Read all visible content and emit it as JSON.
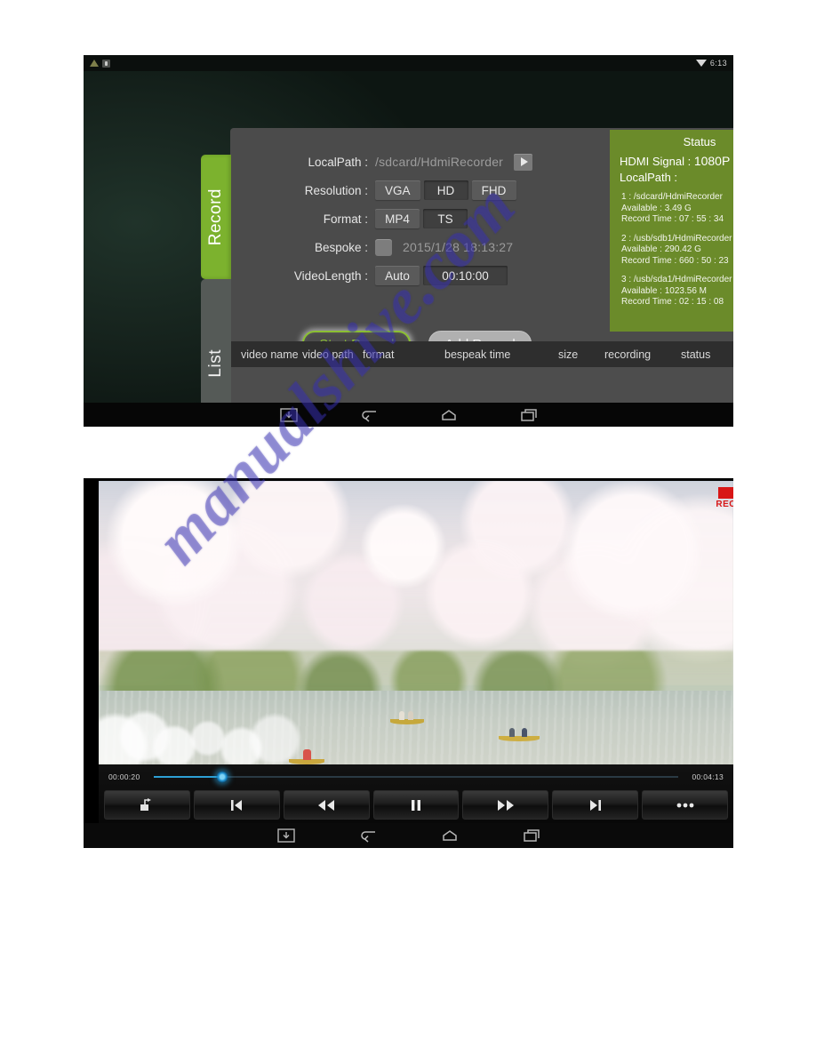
{
  "watermark": {
    "text": "manualshive.com"
  },
  "shot1": {
    "statusbar": {
      "time": "6:13",
      "wifi_icon": "wifi-icon",
      "notif_icons": [
        "triangle-icon",
        "sd-card-icon"
      ]
    },
    "tabs": [
      {
        "label": "Record",
        "active": true,
        "color": "#7cb22e"
      },
      {
        "label": "List",
        "active": false,
        "color": "#555a57"
      }
    ],
    "form": {
      "localpath": {
        "label": "LocalPath :",
        "value": "/sdcard/HdmiRecorder",
        "play_icon": "play-icon"
      },
      "resolution": {
        "label": "Resolution :",
        "options": [
          "VGA",
          "HD",
          "FHD"
        ],
        "selected": "HD"
      },
      "format": {
        "label": "Format :",
        "options": [
          "MP4",
          "TS"
        ],
        "selected": "TS"
      },
      "bespoke": {
        "label": "Bespoke :",
        "checked": false,
        "datetime": "2015/1/28 18:13:27"
      },
      "videolength": {
        "label": "VideoLength :",
        "options": [
          "Auto",
          "00:10:00"
        ],
        "selected": "00:10:00"
      }
    },
    "actions": {
      "start": "Start Record",
      "add": "Add Record"
    },
    "status": {
      "title": "Status",
      "hdmi_label": "HDMI Signal :",
      "hdmi_value": "1080P",
      "localpath_label": "LocalPath :",
      "entries": [
        {
          "index": "1 :",
          "path": "/sdcard/HdmiRecorder",
          "available": "Available : 3.49 G",
          "record_time": "Record Time : 07 : 55 : 34"
        },
        {
          "index": "2 :",
          "path": "/usb/sdb1/HdmiRecorder",
          "available": "Available : 290.42 G",
          "record_time": "Record Time : 660 : 50 : 23"
        },
        {
          "index": "3 :",
          "path": "/usb/sda1/HdmiRecorder",
          "available": "Available : 1023.56 M",
          "record_time": "Record Time : 02 : 15 : 08"
        }
      ]
    },
    "table": {
      "columns": [
        "video name",
        "video path",
        "format",
        "bespeak time",
        "size",
        "recording",
        "status"
      ],
      "rows": []
    },
    "navbar": [
      "screenshot-icon",
      "back-icon",
      "home-icon",
      "recents-icon"
    ]
  },
  "shot2": {
    "rec_badge": "REC",
    "player": {
      "current_time": "00:00:20",
      "total_time": "00:04:13",
      "progress_percent": 13,
      "controls": [
        "eject-icon",
        "previous-icon",
        "rewind-icon",
        "pause-icon",
        "fast-forward-icon",
        "next-icon",
        "more-icon"
      ]
    },
    "navbar": [
      "screenshot-icon",
      "back-icon",
      "home-icon",
      "recents-icon"
    ]
  }
}
